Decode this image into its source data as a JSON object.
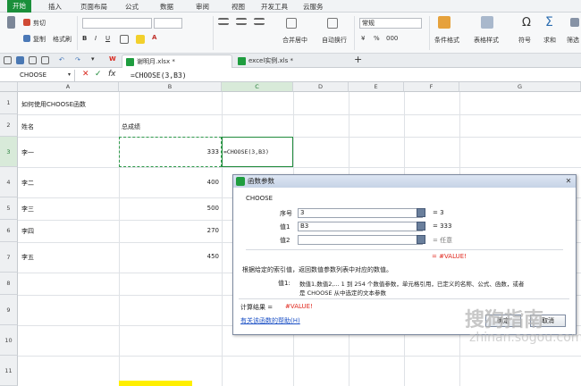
{
  "menu": [
    "开始",
    "插入",
    "页面布局",
    "公式",
    "数据",
    "审阅",
    "视图",
    "开发工具",
    "云服务"
  ],
  "ribbon": {
    "cut": "剪切",
    "copy": "复制",
    "format_painter": "格式刷",
    "font_name": "",
    "font_size": "",
    "merge_center": "合并居中",
    "auto_wrap": "自动换行",
    "number_format": "常规",
    "cond_format": "条件格式",
    "table_style": "表格样式",
    "symbol": "符号",
    "sum": "求和",
    "filter": "筛选",
    "currency": "¥",
    "percent": "%",
    "thousands": "000"
  },
  "tabs": [
    {
      "name": "谢明月.xlsx *",
      "active": true
    },
    {
      "name": "excel实例.xls *",
      "active": false
    }
  ],
  "formula_bar": {
    "name_box": "CHOOSE",
    "formula": "=CHOOSE(3,B3)",
    "cancel": "✕",
    "confirm": "✓",
    "fx": "fx"
  },
  "columns": [
    "A",
    "B",
    "C",
    "D",
    "E",
    "F",
    "G"
  ],
  "rows": [
    "1",
    "2",
    "3",
    "4",
    "5",
    "6",
    "7",
    "8",
    "9",
    "10",
    "11"
  ],
  "cells": {
    "A1": "如何使用CHOOSE函数",
    "A2": "姓名",
    "B2": "总成绩",
    "A3": "李一",
    "B3": "333",
    "C3": "=CHOOSE(3,B3)",
    "A4": "李二",
    "B4": "400",
    "A5": "李三",
    "B5": "500",
    "A6": "李四",
    "B6": "270",
    "A7": "李五",
    "B7": "450"
  },
  "dialog": {
    "title": "函数参数",
    "func_name": "CHOOSE",
    "args": [
      {
        "label": "序号",
        "value": "3",
        "result": "= 3"
      },
      {
        "label": "值1",
        "value": "B3",
        "result": "= 333"
      },
      {
        "label": "值2",
        "value": "",
        "result": "= 任意"
      }
    ],
    "overall_result": "= #VALUE!",
    "description": "根据给定的索引值，返回数值参数列表中对应的数值。",
    "arg_desc_label": "值1:",
    "arg_desc": "数值1,数值2,... 1 到 254 个数值参数，单元格引用，已定义的名称、公式、函数，或者",
    "arg_desc2": "是 CHOOSE 从中选定的文本参数",
    "calc_label": "计算结果 =",
    "calc_value": "#VALUE!",
    "help_link": "有关该函数的帮助(H)",
    "ok": "确定",
    "cancel": "取消"
  },
  "watermark": "搜狗指南",
  "watermark_sub": "zhinan.sogou.com"
}
